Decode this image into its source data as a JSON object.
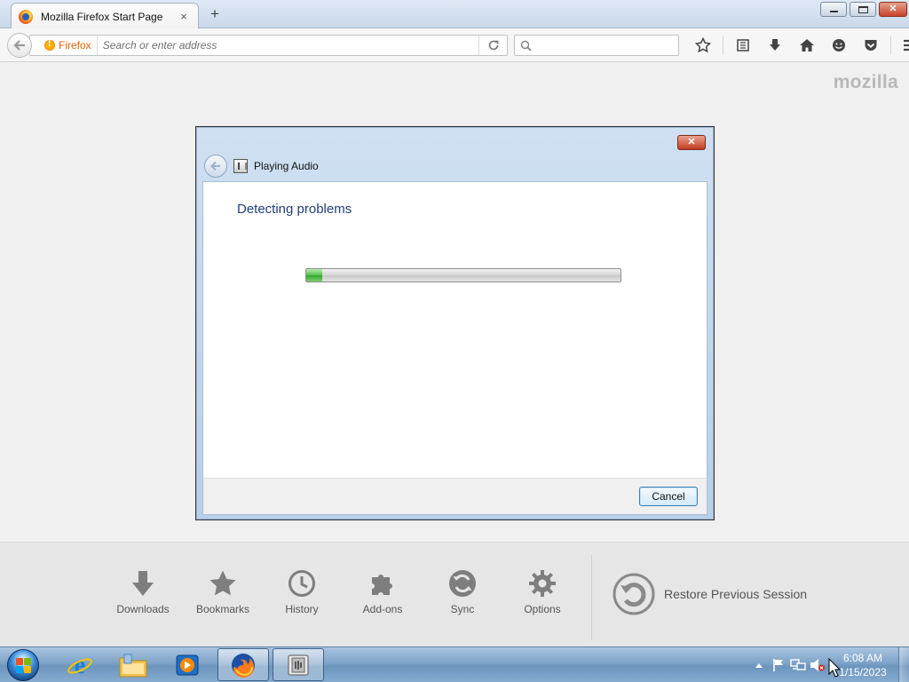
{
  "browser": {
    "tab_title": "Mozilla Firefox Start Page",
    "tab_close": "×",
    "new_tab": "+",
    "identity_label": "Firefox",
    "url_placeholder": "Search or enter address",
    "search_placeholder": "",
    "toolbar_icons": [
      "bookmark-star-icon",
      "reading-list-icon",
      "downloads-icon",
      "home-icon",
      "hello-icon",
      "pocket-icon",
      "menu-icon"
    ]
  },
  "page": {
    "logo": "mozilla",
    "launcher": [
      {
        "label": "Downloads",
        "icon": "download-arrow-icon"
      },
      {
        "label": "Bookmarks",
        "icon": "star-icon"
      },
      {
        "label": "History",
        "icon": "clock-icon"
      },
      {
        "label": "Add-ons",
        "icon": "puzzle-icon"
      },
      {
        "label": "Sync",
        "icon": "sync-icon"
      },
      {
        "label": "Options",
        "icon": "gear-icon"
      }
    ],
    "restore_label": "Restore Previous Session"
  },
  "dialog": {
    "title": "Playing Audio",
    "heading": "Detecting problems",
    "progress_fraction": 0.05,
    "cancel_label": "Cancel"
  },
  "taskbar": {
    "apps": [
      "internet-explorer-icon",
      "windows-explorer-icon",
      "media-player-icon",
      "firefox-icon",
      "troubleshooter-icon"
    ],
    "clock_time": "6:08 AM",
    "clock_date": "1/15/2023",
    "tray_icons": [
      "show-hidden-icons",
      "action-center-flag-icon",
      "network-icon",
      "volume-muted-icon"
    ]
  },
  "colors": {
    "accent": "#1e3f78",
    "progress": "#34a62c",
    "identity": "#e66000",
    "taskbar": "#7ea3c8"
  }
}
